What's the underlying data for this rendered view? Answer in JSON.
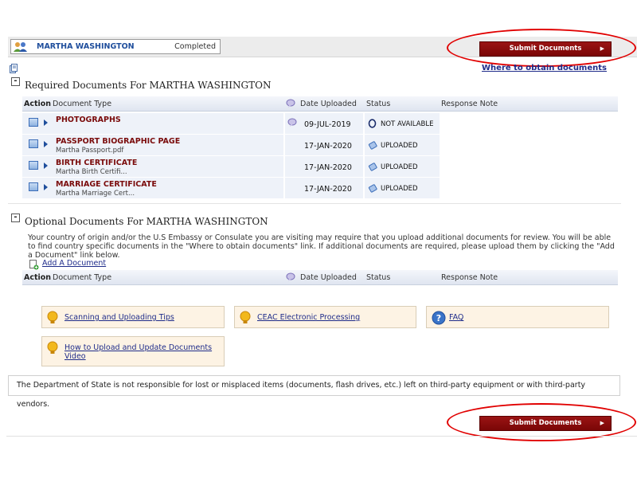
{
  "applicant": {
    "name": "MARTHA WASHINGTON",
    "status": "Completed"
  },
  "submit_label": "Submit Documents",
  "where_link": "Where to obtain documents",
  "required": {
    "title": "Required Documents For MARTHA WASHINGTON",
    "columns": [
      "Action",
      "Document Type",
      "Date Uploaded",
      "Status",
      "Response Note"
    ],
    "rows": [
      {
        "name": "PHOTOGRAPHS",
        "file": "",
        "date": "09-JUL-2019",
        "status": "NOT AVAILABLE",
        "status_icon": "circle-o-icon",
        "has_comment": true
      },
      {
        "name": "PASSPORT BIOGRAPHIC PAGE",
        "file": "Martha Passport.pdf",
        "date": "17-JAN-2020",
        "status": "UPLOADED",
        "status_icon": "paperclip-icon",
        "has_comment": false
      },
      {
        "name": "BIRTH CERTIFICATE",
        "file": "Martha Birth Certifi...",
        "date": "17-JAN-2020",
        "status": "UPLOADED",
        "status_icon": "paperclip-icon",
        "has_comment": false
      },
      {
        "name": "MARRIAGE CERTIFICATE",
        "file": "Martha Marriage Cert...",
        "date": "17-JAN-2020",
        "status": "UPLOADED",
        "status_icon": "paperclip-icon",
        "has_comment": false
      }
    ]
  },
  "optional": {
    "title": "Optional Documents For MARTHA WASHINGTON",
    "description": "Your country of origin and/or the U.S Embassy or Consulate you are visiting may require that you upload additional documents for review. You will be able to find country specific documents in the \"Where to obtain documents\" link. If additional documents are required, please upload them by clicking the \"Add a Document\" link below.",
    "add_link": "Add A Document",
    "columns": [
      "Action",
      "Document Type",
      "Date Uploaded",
      "Status",
      "Response Note"
    ]
  },
  "help_links": {
    "scanning": "Scanning and Uploading Tips",
    "ceac": "CEAC Electronic Processing",
    "faq": "FAQ",
    "video": "How to Upload and Update Documents Video"
  },
  "disclaimer": "The Department of State is not responsible for lost or misplaced items (documents, flash drives, etc.) left on third-party equipment or with third-party vendors.",
  "colors": {
    "brand_red": "#8a0c0c",
    "link_blue": "#1f2c8a",
    "annotation_red": "#e10000"
  }
}
